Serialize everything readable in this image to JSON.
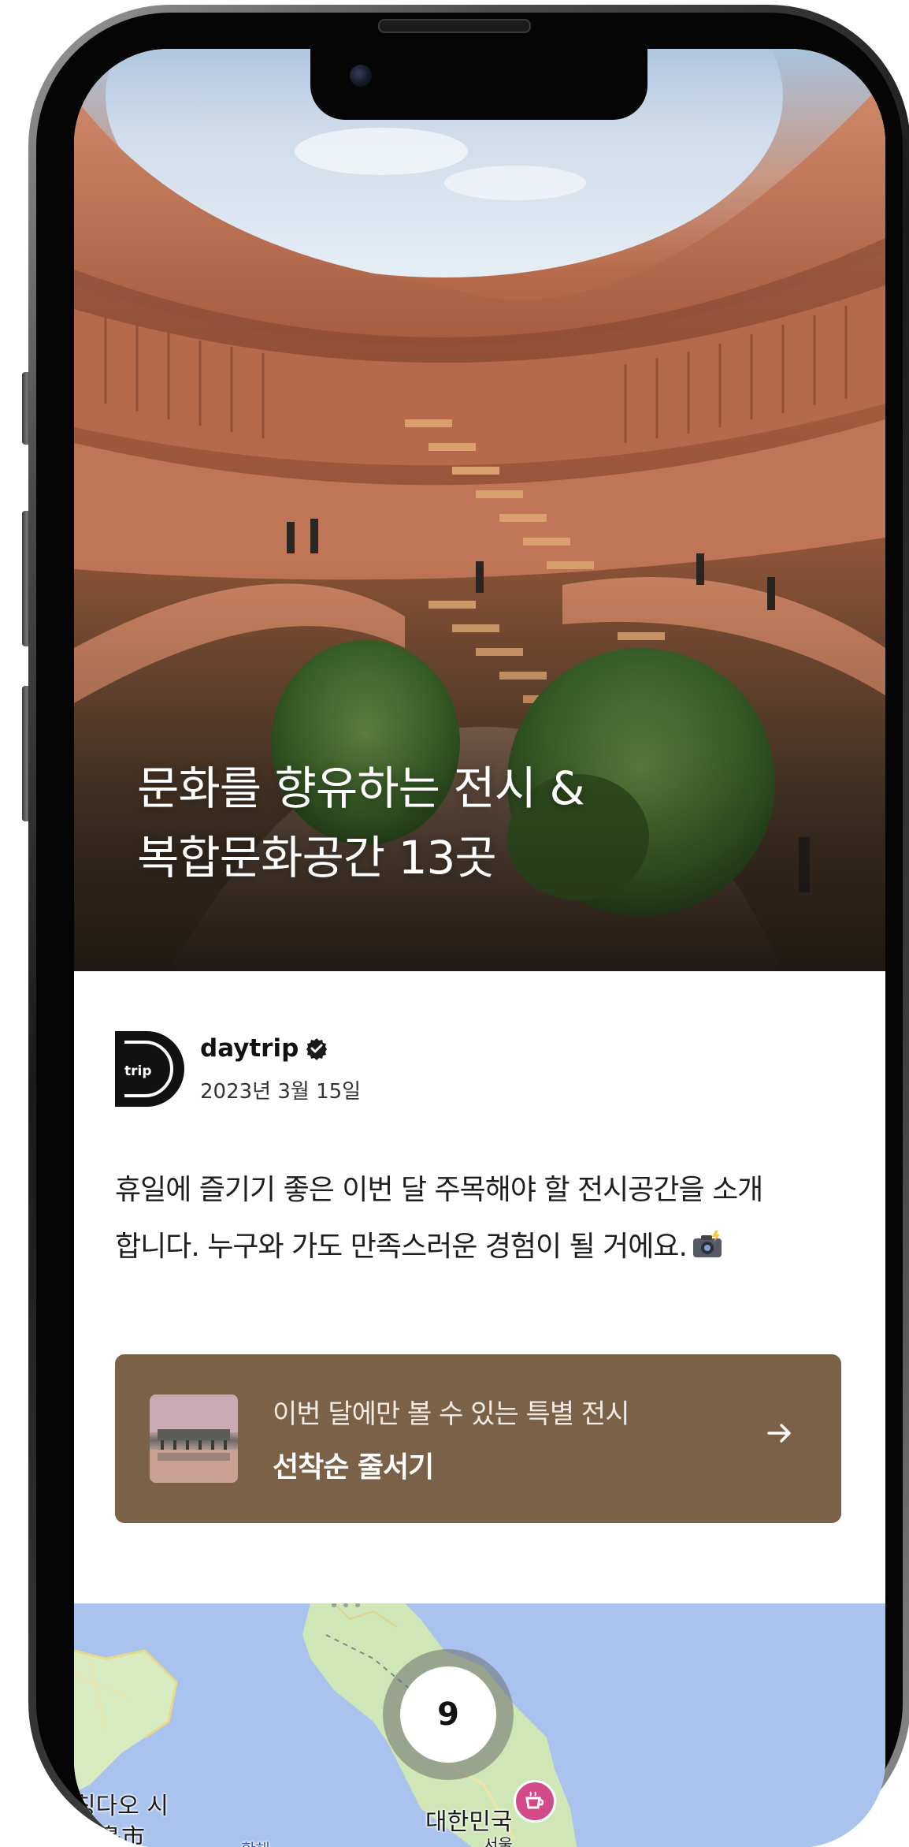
{
  "hero": {
    "title_line1": "문화를 향유하는 전시 &",
    "title_line2": "복합문화공간 13곳"
  },
  "author": {
    "logo_text": "trip",
    "name": "daytrip",
    "date": "2023년 3월 15일"
  },
  "description": {
    "line1": "휴일에 즐기기 좋은 이번 달 주목해야 할 전시공간을 소개",
    "line2": "합니다. 누구와 가도 만족스러운 경험이 될 거에요."
  },
  "cta": {
    "subtitle": "이번 달에만 볼 수 있는 특별 전시",
    "title": "선착순 줄서기",
    "arrow": "→"
  },
  "map": {
    "cluster_count": "9",
    "label_qingdao": "칭다오 시",
    "label_qingdao_cn": "青島市",
    "label_korea": "대한민국",
    "label_sea": "황해",
    "label_partial": "서울"
  },
  "colors": {
    "cta_bg": "#7b6148",
    "map_water": "#a9c3ee",
    "map_land": "#cfe6b6"
  },
  "icons": {
    "verified": "verified-badge-icon",
    "arrow": "arrow-right-icon",
    "camera": "camera-flash-icon",
    "cafe": "cafe-pin-icon"
  }
}
